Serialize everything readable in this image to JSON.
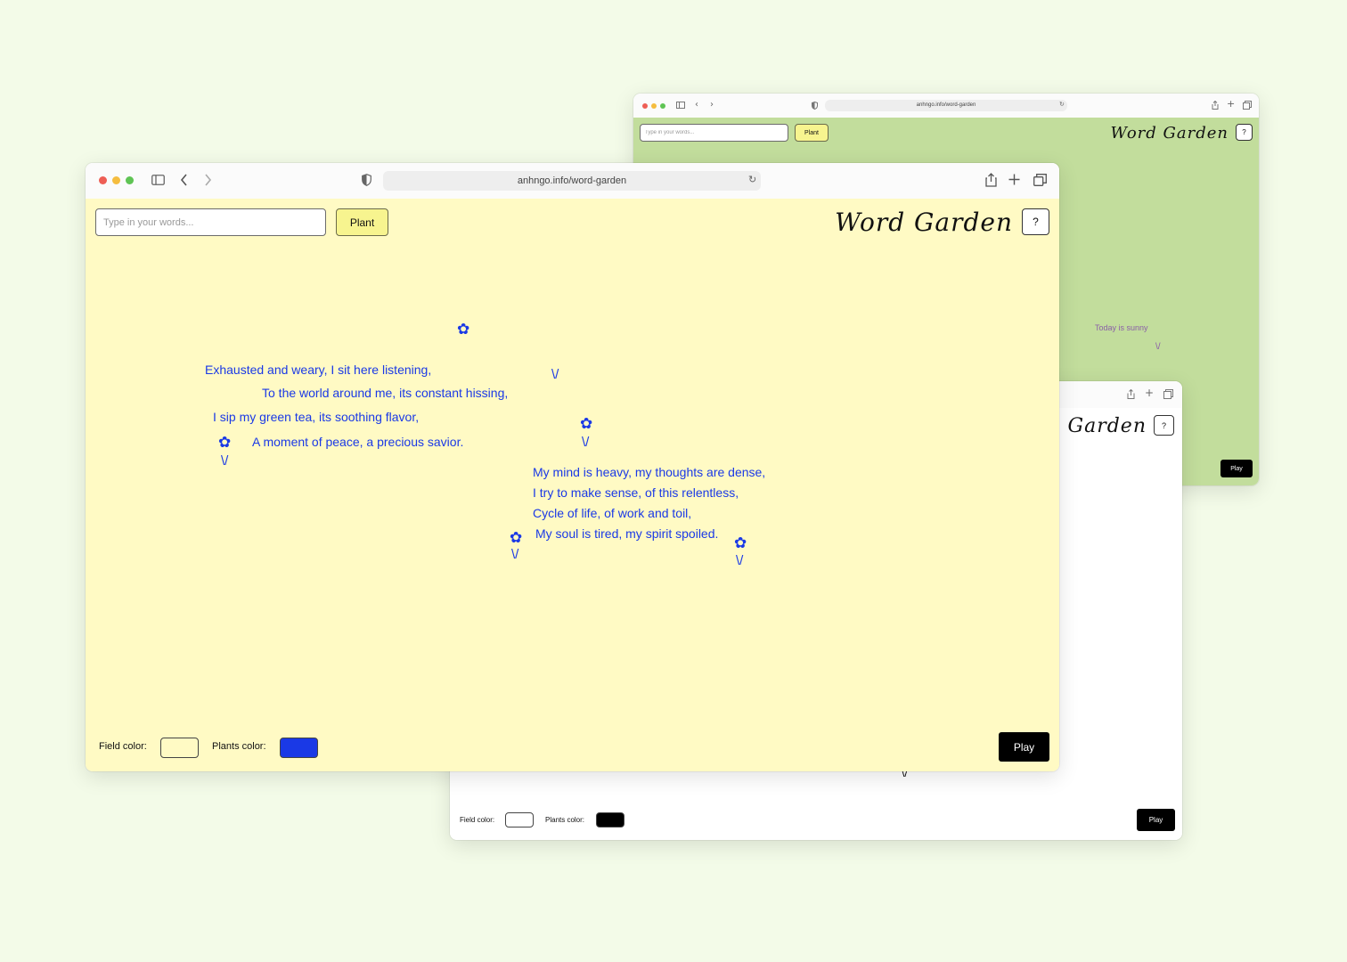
{
  "back_green_window": {
    "url": "anhngo.info/word-garden",
    "field_color": "#c2dd9c",
    "input_placeholder": "Type in your words...",
    "plant_label": "Plant",
    "title": "Word Garden",
    "help_label": "?",
    "poem_text": "Today is sunny",
    "poem_color": "#8a5fa8",
    "stem": "\\/",
    "play_label": "Play"
  },
  "back_white_window": {
    "field_color": "#ffffff",
    "plants_color": "#000000",
    "title": "Word Garden",
    "help_label": "?",
    "field_color_label": "Field color:",
    "plants_color_label": "Plants color:",
    "stem": "\\/",
    "play_label": "Play"
  },
  "front_window": {
    "url": "anhngo.info/word-garden",
    "field_color": "#fffac4",
    "plants_color": "#1a39e6",
    "input_placeholder": "Type in your words...",
    "plant_label": "Plant",
    "title": "Word Garden",
    "help_label": "?",
    "field_color_label": "Field color:",
    "plants_color_label": "Plants color:",
    "play_label": "Play",
    "flower_glyph": "✿",
    "stem": "\\/",
    "poem": [
      "Exhausted and weary, I sit here listening,",
      "To the world around me, its constant hissing,",
      "I sip my green tea, its soothing flavor,",
      "A moment of peace, a precious savior.",
      "My mind is heavy, my thoughts are dense,",
      "I try to make sense, of this relentless,",
      "Cycle of life, of work and toil,",
      "My soul is tired, my spirit spoiled."
    ]
  },
  "traffic_light_colors": [
    "#ee5e55",
    "#f5bd3f",
    "#5fc454"
  ]
}
